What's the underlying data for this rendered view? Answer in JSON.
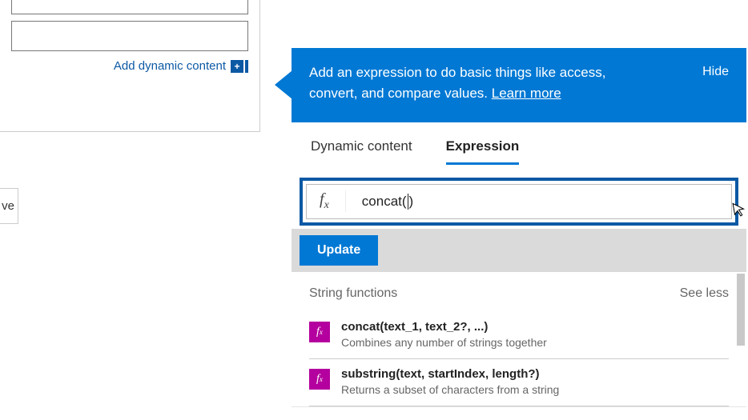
{
  "left": {
    "add_dynamic": "Add dynamic content",
    "bottom_fragment": "ve"
  },
  "panel": {
    "banner_text_1": "Add an expression to do basic things like access, convert, and compare values. ",
    "banner_link": "Learn more",
    "hide": "Hide",
    "tabs": {
      "dynamic": "Dynamic content",
      "expression": "Expression"
    },
    "expr": {
      "fx": "f",
      "fx_sub": "x",
      "before": "concat(",
      "after": ")"
    },
    "update": "Update",
    "section": {
      "title": "String functions",
      "toggle": "See less"
    },
    "functions": [
      {
        "sig": "concat(text_1, text_2?, ...)",
        "desc": "Combines any number of strings together"
      },
      {
        "sig": "substring(text, startIndex, length?)",
        "desc": "Returns a subset of characters from a string"
      }
    ]
  }
}
